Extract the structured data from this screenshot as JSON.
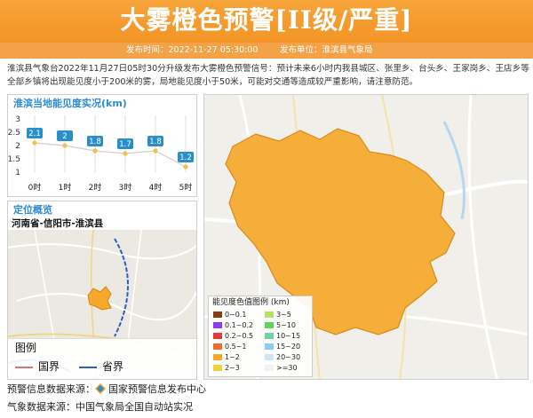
{
  "header": {
    "title": "大雾橙色预警[II级/严重]",
    "publish_time": "发布时间：2022-11-27 05:30:00",
    "publisher": "发布单位：淮滨县气象局",
    "bg_color": "#f39a2e"
  },
  "description": "淮滨县气象台2022年11月27日05时30分升级发布大雾橙色预警信号：预计未来6小时内我县城区、张里乡、台头乡、王家岗乡、王店乡等全部乡镇将出现能见度小于200米的雾，局地能见度小于50米，可能对交通等造成较严重影响，请注意防范。",
  "visibility_panel": {
    "title": "淮滨当地能见度实况(km)"
  },
  "chart_data": {
    "type": "line",
    "categories": [
      "0时",
      "1时",
      "2时",
      "3时",
      "4时",
      "5时"
    ],
    "values": [
      2.1,
      2,
      1.8,
      1.7,
      1.8,
      1.2
    ],
    "data_labels": [
      "2.1",
      "2",
      "1.8",
      "1.7",
      "1.8",
      "1.2"
    ],
    "ylim": [
      1,
      3
    ],
    "yticks": [
      "1",
      "1.5",
      "2",
      "2.5",
      "3"
    ],
    "grid": true,
    "line_color": "#f2c14a",
    "label_color": "#2a8fc9"
  },
  "location_panel": {
    "title": "定位概览",
    "subtitle": "河南省-信阳市-淮滨县",
    "legend_title": "图例",
    "legend_items": [
      {
        "label": "国界",
        "color": "#d9747a"
      },
      {
        "label": "省界",
        "color": "#2a5fc8"
      }
    ]
  },
  "map_legend": {
    "title": "能见度色值图例 (km)",
    "items": [
      {
        "label": "0~0.1",
        "color": "#8b3a12"
      },
      {
        "label": "3~5",
        "color": "#b6e35c"
      },
      {
        "label": "0.1~0.2",
        "color": "#8b3ef0"
      },
      {
        "label": "5~10",
        "color": "#5ed45a"
      },
      {
        "label": "0.2~0.5",
        "color": "#e23a3a"
      },
      {
        "label": "10~15",
        "color": "#6fd3a8"
      },
      {
        "label": "0.5~1",
        "color": "#f26a2e"
      },
      {
        "label": "15~20",
        "color": "#87cff0"
      },
      {
        "label": "1~2",
        "color": "#f5a82a"
      },
      {
        "label": "20~30",
        "color": "#cde8f6"
      },
      {
        "label": "2~3",
        "color": "#f2d23a"
      },
      {
        "label": ">=30",
        "color": "#f2f2f2"
      }
    ]
  },
  "footer": {
    "source1": "预警信息数据来源：",
    "source1_name": "国家预警信息发布中心",
    "source2": "气象数据来源：中国气象局全国自动站实况"
  }
}
